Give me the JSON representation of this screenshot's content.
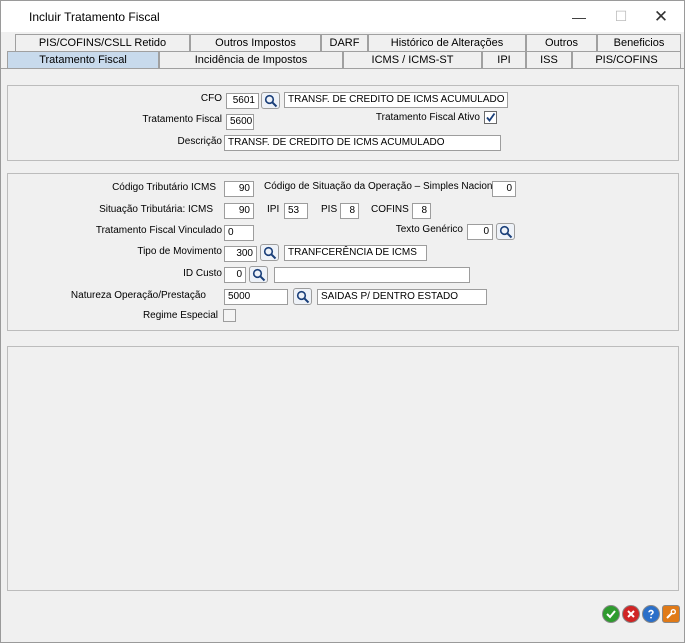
{
  "window": {
    "title": "Incluir Tratamento Fiscal",
    "minimize_glyph": "—",
    "maximize_glyph": "☐",
    "close_glyph": "✕"
  },
  "tabs": {
    "row1": [
      "PIS/COFINS/CSLL Retido",
      "Outros Impostos",
      "DARF",
      "Histórico de Alterações",
      "Outros",
      "Beneficios"
    ],
    "row2": [
      "Tratamento Fiscal",
      "Incidência de Impostos",
      "ICMS / ICMS-ST",
      "IPI",
      "ISS",
      "PIS/COFINS"
    ],
    "active": "Tratamento Fiscal"
  },
  "section1": {
    "cfo_label": "CFO",
    "cfo_value": "5601",
    "cfo_desc": "TRANSF. DE CREDITO DE ICMS ACUMULADO",
    "tratamento_label": "Tratamento Fiscal",
    "tratamento_value": "5600",
    "ativo_label": "Tratamento Fiscal Ativo",
    "ativo_checked": true,
    "descricao_label": "Descrição",
    "descricao_value": "TRANSF. DE CREDITO DE ICMS ACUMULADO"
  },
  "section2": {
    "cod_trib_label": "Código Tributário ICMS",
    "cod_trib_value": "90",
    "csosn_label": "Código de Situação da Operação – Simples Nacional",
    "csosn_value": "0",
    "sit_trib_label": "Situação Tributária: ICMS",
    "sit_trib_value": "90",
    "ipi_label": "IPI",
    "ipi_value": "53",
    "pis_label": "PIS",
    "pis_value": "8",
    "cofins_label": "COFINS",
    "cofins_value": "8",
    "vinculado_label": "Tratamento Fiscal Vinculado",
    "vinculado_value": "0",
    "texto_label": "Texto Genérico",
    "texto_value": "0",
    "tipo_mov_label": "Tipo de Movimento",
    "tipo_mov_value": "300",
    "tipo_mov_desc": "TRANFCERÊNCIA DE ICMS",
    "id_custo_label": "ID Custo",
    "id_custo_value": "0",
    "id_custo_desc": "",
    "natureza_label": "Natureza Operação/Prestação",
    "natureza_value": "5000",
    "natureza_desc": "SAIDAS P/ DENTRO ESTADO",
    "regime_label": "Regime Especial",
    "regime_checked": false
  },
  "footer": {
    "ok_color": "#2e9b2e",
    "cancel_color": "#d02424",
    "help_color": "#2a6fc9",
    "tool_color": "#e07a18"
  }
}
